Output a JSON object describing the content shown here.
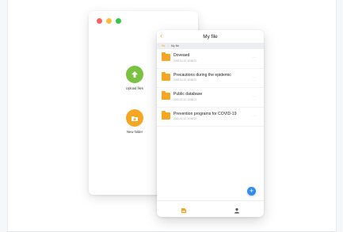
{
  "desktop": {
    "traffic_lights": [
      "#fc605c",
      "#fdbc40",
      "#34c84a"
    ],
    "upload": {
      "label": "Upload files",
      "color": "#7cc242",
      "icon": "arrow-up-icon"
    },
    "new_folder": {
      "label": "New folder",
      "color": "#f5a623",
      "icon": "folder-add-icon"
    }
  },
  "phone": {
    "title": "My file",
    "breadcrumb": [
      "file",
      "My file"
    ],
    "files": [
      {
        "name": "Doveaed",
        "date": "2020-02-12 10:56:21"
      },
      {
        "name": "Precautions during the epidemic",
        "date": "2020-02-12 10:56:21"
      },
      {
        "name": "Public database",
        "date": "2020-02-12 10:56:21"
      },
      {
        "name": "Prevention programs for COVID-19",
        "date": "2020-02-12 10:56:21"
      }
    ],
    "fab_label": "+",
    "tabs": [
      {
        "label": "file",
        "active": true,
        "color": "#f5a623"
      },
      {
        "label": "My",
        "active": false,
        "color": "#666666"
      }
    ]
  }
}
